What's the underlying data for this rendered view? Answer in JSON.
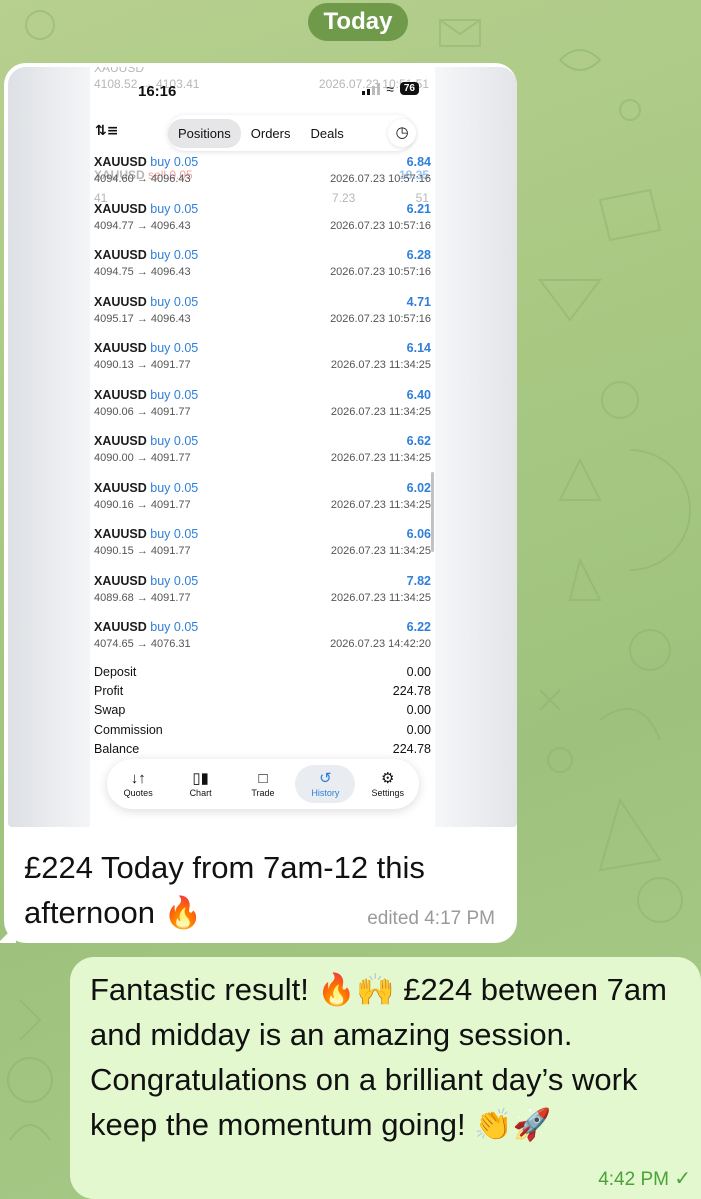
{
  "chat": {
    "day_label": "Today",
    "incoming": {
      "caption": "£224 Today from 7am-12 this afternoon 🔥",
      "edited_label": "edited 4:17 PM",
      "screenshot": {
        "status_time": "16:16",
        "battery": "76",
        "ghost_top_left": "4108.52 → 4103.41",
        "ghost_top_right": "2026.07.23 10:51:51",
        "ghost_symbol": "XAUUSD",
        "ghost_side": "sell 0.05",
        "ghost_pl": "18.35",
        "ghost_second_left": "41",
        "ghost_second_right": "7.23",
        "ghost_seconds": "51",
        "tabs": [
          "Positions",
          "Orders",
          "Deals"
        ],
        "active_tab": "Positions",
        "trades": [
          {
            "symbol": "XAUUSD",
            "side": "buy 0.05",
            "prices": "4094.60 → 4096.43",
            "profit": "6.84",
            "time": "2026.07.23 10:57:16"
          },
          {
            "symbol": "XAUUSD",
            "side": "buy 0.05",
            "prices": "4094.77 → 4096.43",
            "profit": "6.21",
            "time": "2026.07.23 10:57:16"
          },
          {
            "symbol": "XAUUSD",
            "side": "buy 0.05",
            "prices": "4094.75 → 4096.43",
            "profit": "6.28",
            "time": "2026.07.23 10:57:16"
          },
          {
            "symbol": "XAUUSD",
            "side": "buy 0.05",
            "prices": "4095.17 → 4096.43",
            "profit": "4.71",
            "time": "2026.07.23 10:57:16"
          },
          {
            "symbol": "XAUUSD",
            "side": "buy 0.05",
            "prices": "4090.13 → 4091.77",
            "profit": "6.14",
            "time": "2026.07.23 11:34:25"
          },
          {
            "symbol": "XAUUSD",
            "side": "buy 0.05",
            "prices": "4090.06 → 4091.77",
            "profit": "6.40",
            "time": "2026.07.23 11:34:25"
          },
          {
            "symbol": "XAUUSD",
            "side": "buy 0.05",
            "prices": "4090.00 → 4091.77",
            "profit": "6.62",
            "time": "2026.07.23 11:34:25"
          },
          {
            "symbol": "XAUUSD",
            "side": "buy 0.05",
            "prices": "4090.16 → 4091.77",
            "profit": "6.02",
            "time": "2026.07.23 11:34:25"
          },
          {
            "symbol": "XAUUSD",
            "side": "buy 0.05",
            "prices": "4090.15 → 4091.77",
            "profit": "6.06",
            "time": "2026.07.23 11:34:25"
          },
          {
            "symbol": "XAUUSD",
            "side": "buy 0.05",
            "prices": "4089.68 → 4091.77",
            "profit": "7.82",
            "time": "2026.07.23 11:34:25"
          },
          {
            "symbol": "XAUUSD",
            "side": "buy 0.05",
            "prices": "4074.65 → 4076.31",
            "profit": "6.22",
            "time": "2026.07.23 14:42:20"
          }
        ],
        "summary": [
          {
            "label": "Deposit",
            "value": "0.00"
          },
          {
            "label": "Profit",
            "value": "224.78"
          },
          {
            "label": "Swap",
            "value": "0.00"
          },
          {
            "label": "Commission",
            "value": "0.00"
          },
          {
            "label": "Balance",
            "value": "224.78"
          }
        ],
        "nav": [
          {
            "label": "Quotes",
            "icon": "quotes-icon"
          },
          {
            "label": "Chart",
            "icon": "candlestick-icon"
          },
          {
            "label": "Trade",
            "icon": "trade-chart-icon"
          },
          {
            "label": "History",
            "icon": "history-icon"
          },
          {
            "label": "Settings",
            "icon": "gear-icon"
          }
        ],
        "active_nav": "History",
        "accent_color": "#2f7fd8"
      }
    },
    "outgoing": {
      "text": "Fantastic result! 🔥🙌 £224 between 7am and midday is an amazing session. Congratulations on a brilliant day’s work keep the momentum going! 👏🚀",
      "time": "4:42 PM",
      "status_icon": "read-check-icon"
    },
    "colors": {
      "day_pill": "#6f9a49",
      "outgoing_bubble": "#e3f8ce",
      "incoming_bubble": "#ffffff",
      "time_green": "#4aa23a"
    }
  }
}
